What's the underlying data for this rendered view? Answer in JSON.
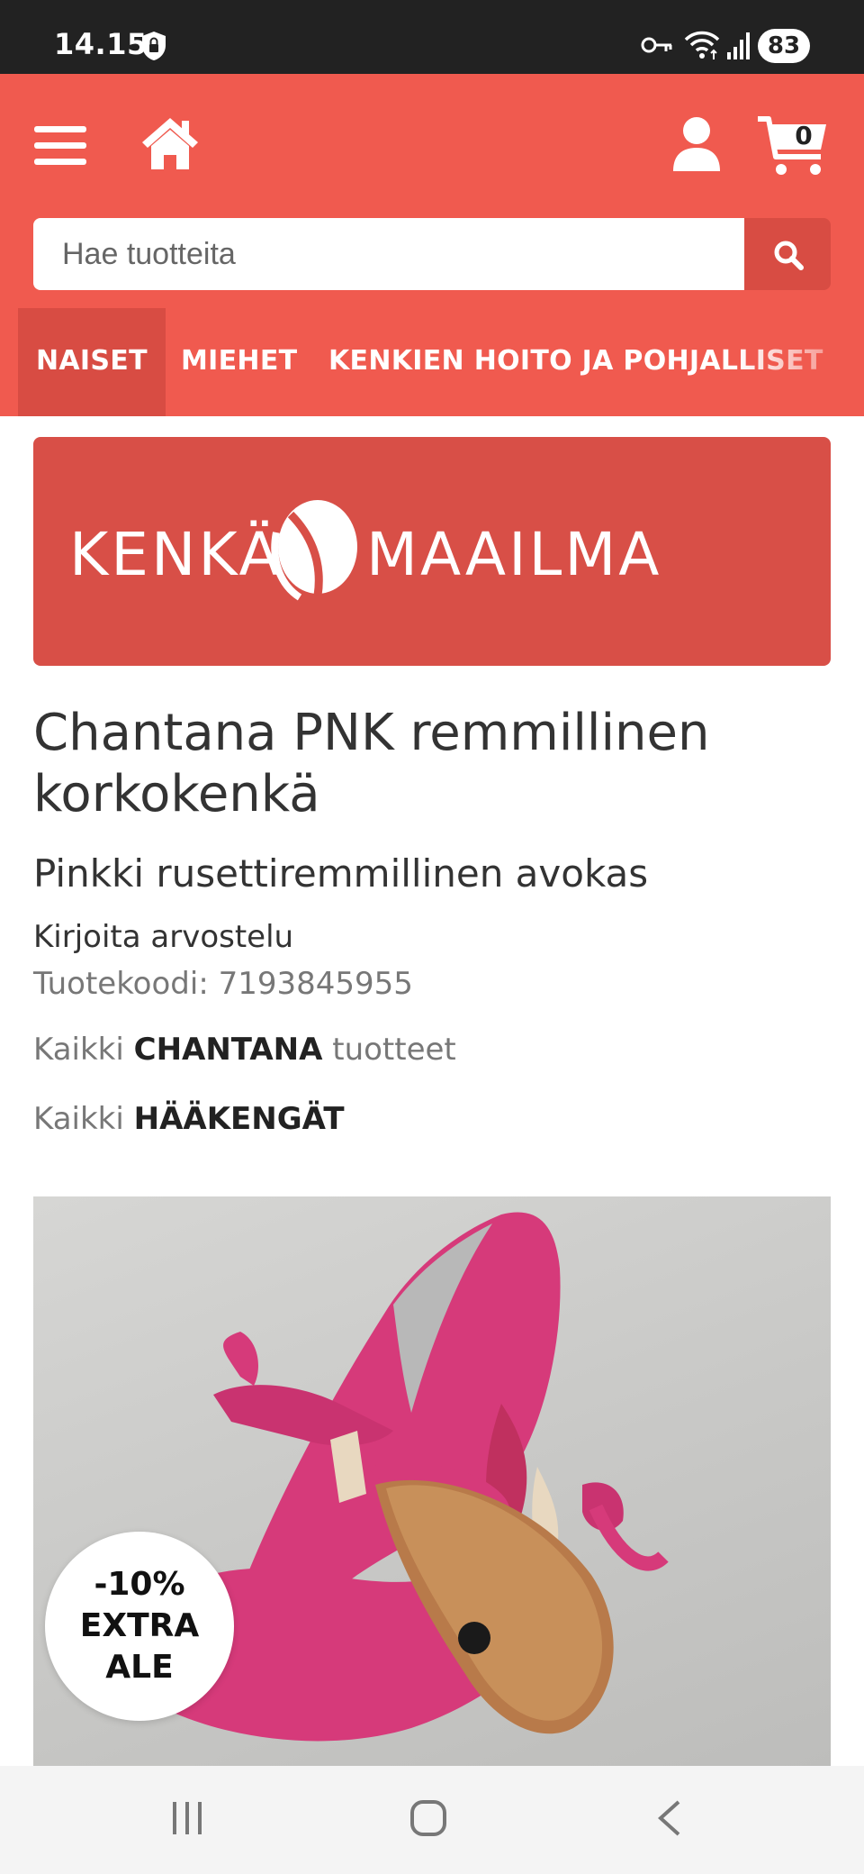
{
  "status_bar": {
    "time": "14.15",
    "battery": "83"
  },
  "header": {
    "cart_count": "0",
    "search": {
      "placeholder": "Hae tuotteita"
    },
    "nav": [
      {
        "label": "NAISET",
        "active": true
      },
      {
        "label": "MIEHET",
        "active": false
      },
      {
        "label": "KENKIEN HOITO JA POHJALLISET",
        "active": false
      }
    ]
  },
  "logo": {
    "left": "KENKÄ",
    "right": "MAAILMA"
  },
  "product": {
    "title": "Chantana PNK remmillinen korkokenkä",
    "subtitle": "Pinkki rusettiremmillinen avokas",
    "review_link": "Kirjoita arvostelu",
    "code_label": "Tuotekoodi:",
    "code_value": "7193845955",
    "all_brand_prefix": "Kaikki",
    "all_brand_name": "CHANTANA",
    "all_brand_suffix": "tuotteet",
    "all_category_prefix": "Kaikki",
    "all_category_name": "HÄÄKENGÄT",
    "sale_badge": [
      "-10%",
      "EXTRA",
      "ALE"
    ]
  },
  "colors": {
    "brand_red": "#f05a4f",
    "brand_red_dark": "#d84c43",
    "shoe_pink": "#d63a7a"
  },
  "icons": {
    "menu": "hamburger-menu-icon",
    "home": "home-icon",
    "user": "user-icon",
    "cart": "shopping-cart-icon",
    "search": "search-icon"
  }
}
